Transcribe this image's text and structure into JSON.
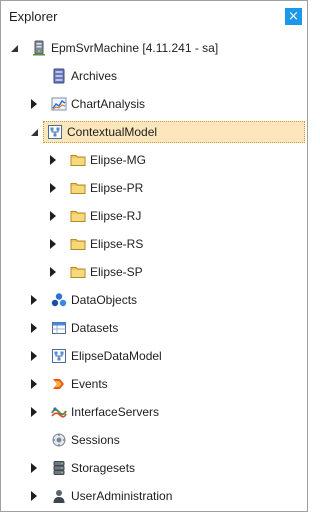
{
  "panel": {
    "title": "Explorer",
    "close_glyph": "×"
  },
  "tree": {
    "root": {
      "label": "EpmSvrMachine [4.11.241 - sa]",
      "icon": "server-icon",
      "expanded": true
    },
    "archives": {
      "label": "Archives",
      "icon": "archive-icon"
    },
    "chart_analysis": {
      "label": "ChartAnalysis",
      "icon": "chart-icon",
      "expanded": false
    },
    "contextual_model": {
      "label": "ContextualModel",
      "icon": "model-icon",
      "expanded": true,
      "selected": true
    },
    "elipse_mg": {
      "label": "Elipse-MG",
      "icon": "folder-icon",
      "expanded": false
    },
    "elipse_pr": {
      "label": "Elipse-PR",
      "icon": "folder-icon",
      "expanded": false
    },
    "elipse_rj": {
      "label": "Elipse-RJ",
      "icon": "folder-icon",
      "expanded": false
    },
    "elipse_rs": {
      "label": "Elipse-RS",
      "icon": "folder-icon",
      "expanded": false
    },
    "elipse_sp": {
      "label": "Elipse-SP",
      "icon": "folder-icon",
      "expanded": false
    },
    "data_objects": {
      "label": "DataObjects",
      "icon": "data-objects-icon",
      "expanded": false
    },
    "datasets": {
      "label": "Datasets",
      "icon": "dataset-icon",
      "expanded": false
    },
    "elipse_data_model": {
      "label": "ElipseDataModel",
      "icon": "model-icon",
      "expanded": false
    },
    "events": {
      "label": "Events",
      "icon": "events-icon",
      "expanded": false
    },
    "interface_servers": {
      "label": "InterfaceServers",
      "icon": "interface-servers-icon",
      "expanded": false
    },
    "sessions": {
      "label": "Sessions",
      "icon": "sessions-icon"
    },
    "storagesets": {
      "label": "Storagesets",
      "icon": "storage-icon",
      "expanded": false
    },
    "user_administration": {
      "label": "UserAdministration",
      "icon": "user-admin-icon",
      "expanded": false
    }
  },
  "colors": {
    "selection_bg": "#fce6bb",
    "selection_border": "#c89b3c",
    "close_button": "#1c97ea",
    "folder": "#f0c75a"
  }
}
